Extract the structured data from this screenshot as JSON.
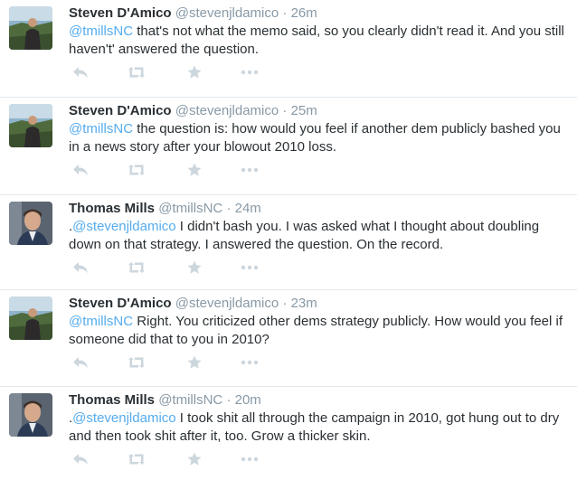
{
  "tweets": [
    {
      "name": "Steven D'Amico",
      "handle": "@stevenjldamico",
      "separator": "·",
      "time": "26m",
      "prefix": "",
      "mention": "@tmillsNC",
      "body": " that's not what the memo said, so you clearly didn't read it. And you still haven't' answered the question.",
      "avatar": "photo-coast"
    },
    {
      "name": "Steven D'Amico",
      "handle": "@stevenjldamico",
      "separator": "·",
      "time": "25m",
      "prefix": "",
      "mention": "@tmillsNC",
      "body": " the question is: how would you feel if another dem publicly bashed you in a news story after your blowout 2010 loss.",
      "avatar": "photo-coast"
    },
    {
      "name": "Thomas Mills",
      "handle": "@tmillsNC",
      "separator": "·",
      "time": "24m",
      "prefix": ".",
      "mention": "@stevenjldamico",
      "body": " I didn't bash you. I was asked what I thought about doubling down on that strategy. I answered the question. On the record.",
      "avatar": "photo-headshot"
    },
    {
      "name": "Steven D'Amico",
      "handle": "@stevenjldamico",
      "separator": "·",
      "time": "23m",
      "prefix": "",
      "mention": "@tmillsNC",
      "body": " Right. You criticized other dems strategy publicly. How would you feel if someone did that to you in 2010?",
      "avatar": "photo-coast"
    },
    {
      "name": "Thomas Mills",
      "handle": "@tmillsNC",
      "separator": "·",
      "time": "20m",
      "prefix": ".",
      "mention": "@stevenjldamico",
      "body": " I took shit all through the campaign in 2010, got hung out to dry and then took shit after it, too. Grow a thicker skin.",
      "avatar": "photo-headshot"
    }
  ],
  "actions": [
    "reply-icon",
    "retweet-icon",
    "favorite-icon",
    "more-icon"
  ],
  "colors": {
    "name": "#292f33",
    "meta": "#8899a6",
    "mention": "#55acee",
    "action_icon": "#ccd6dd",
    "divider": "#e1e8ed"
  }
}
